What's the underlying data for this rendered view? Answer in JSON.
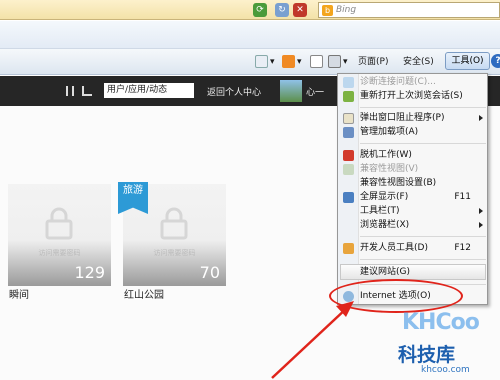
{
  "address_bar": {
    "search_placeholder": "Bing"
  },
  "command_bar": {
    "page_label": "页面(P)",
    "security_label": "安全(S)",
    "tools_label": "工具(O)"
  },
  "site_bar": {
    "search_value": "用户/应用/动态",
    "back_link": "返回个人中心",
    "user_fragment": "心一"
  },
  "cards": [
    {
      "title": "瞬间",
      "locked_text": "访问需要密码",
      "count": "129",
      "badge": ""
    },
    {
      "title": "红山公园",
      "locked_text": "访问需要密码",
      "count": "70",
      "badge": "旅游"
    }
  ],
  "tools_menu": {
    "items": [
      {
        "label": "诊断连接问题(C)...",
        "shortcut": "",
        "submenu": false,
        "disabled": true,
        "icon": "diagnose-icon"
      },
      {
        "label": "重新打开上次浏览会话(S)",
        "shortcut": "",
        "submenu": false,
        "disabled": false,
        "icon": "reopen-session-icon"
      },
      {
        "label": "弹出窗口阻止程序(P)",
        "shortcut": "",
        "submenu": true,
        "disabled": false,
        "icon": "popup-blocker-icon"
      },
      {
        "label": "管理加载项(A)",
        "shortcut": "",
        "submenu": false,
        "disabled": false,
        "icon": "addons-icon"
      },
      {
        "label": "脱机工作(W)",
        "shortcut": "",
        "submenu": false,
        "disabled": false,
        "icon": "work-offline-icon"
      },
      {
        "label": "兼容性视图(V)",
        "shortcut": "",
        "submenu": false,
        "disabled": true,
        "icon": "compat-view-icon"
      },
      {
        "label": "兼容性视图设置(B)",
        "shortcut": "",
        "submenu": false,
        "disabled": false,
        "icon": ""
      },
      {
        "label": "全屏显示(F)",
        "shortcut": "F11",
        "submenu": false,
        "disabled": false,
        "icon": "fullscreen-icon"
      },
      {
        "label": "工具栏(T)",
        "shortcut": "",
        "submenu": true,
        "disabled": false,
        "icon": ""
      },
      {
        "label": "浏览器栏(X)",
        "shortcut": "",
        "submenu": true,
        "disabled": false,
        "icon": ""
      },
      {
        "label": "开发人员工具(D)",
        "shortcut": "F12",
        "submenu": false,
        "disabled": false,
        "icon": "dev-tools-icon"
      },
      {
        "label": "建议网站(G)",
        "shortcut": "",
        "submenu": false,
        "disabled": false,
        "icon": ""
      },
      {
        "label": "Internet 选项(O)",
        "shortcut": "",
        "submenu": false,
        "disabled": false,
        "icon": "internet-options-icon"
      }
    ]
  },
  "watermark": {
    "logo": "KHCoo",
    "name": "科技库",
    "url": "khcoo.com"
  },
  "colors": {
    "annotation_red": "#e0241b",
    "menu_bg": "#f7f7f7",
    "site_bar_bg": "#262626",
    "badge_blue": "#2d9ad6"
  }
}
